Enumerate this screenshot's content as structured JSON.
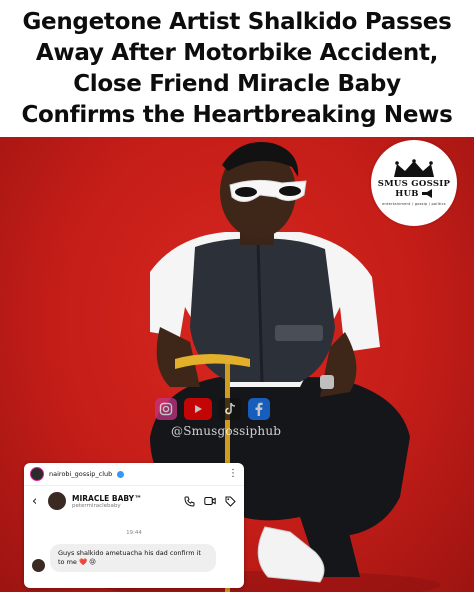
{
  "headline": {
    "line1": "Gengetone Artist Shalkido Passes",
    "line2": "Away After Motorbike Accident,",
    "line3": "Close Friend Miracle Baby",
    "line4": "Confirms the Heartbreaking News"
  },
  "brand": {
    "name_line1": "SMUS GOSSIP",
    "name_line2": "HUB",
    "tagline": "entertainment / gossip / politics",
    "handle": "@Smusgossiphub"
  },
  "social_icons": [
    "instagram-icon",
    "youtube-icon",
    "tiktok-icon",
    "facebook-icon"
  ],
  "colors": {
    "background_red": "#c41d18",
    "headline_text": "#0d0d0d",
    "instagram": "#d6249f",
    "youtube": "#ff0000",
    "facebook": "#1877f2"
  },
  "screenshot": {
    "account": "nairobi_gossip_club",
    "chat_name": "MIRACLE BABY™",
    "chat_handle": "petermiraclebaby",
    "timestamp": "19:44",
    "message": "Guys shalkido ametuacha his dad confirm it to me ❤️ 😢"
  }
}
